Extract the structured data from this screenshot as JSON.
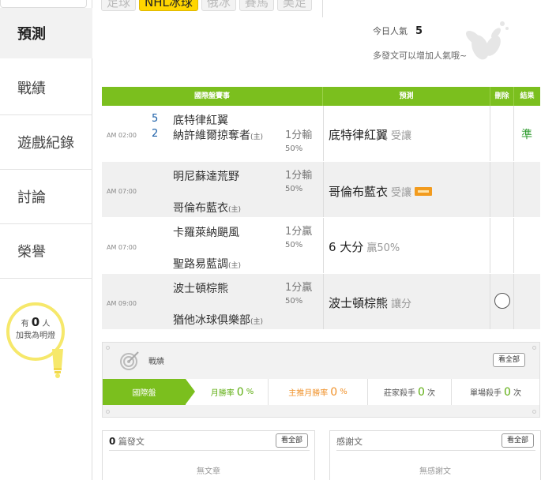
{
  "tabs": [
    {
      "label": "足球"
    },
    {
      "label": "NHL冰球"
    },
    {
      "label": "俄冰"
    },
    {
      "label": "賽馬"
    },
    {
      "label": "美足"
    }
  ],
  "sidebar": {
    "items": [
      {
        "label": "預測"
      },
      {
        "label": "戰績"
      },
      {
        "label": "遊戲紀錄"
      },
      {
        "label": "討論"
      },
      {
        "label": "榮譽"
      }
    ],
    "fans_prefix": "有",
    "fans_count": "0",
    "fans_unit": "人",
    "fans_text": "加我為明燈"
  },
  "popularity": {
    "label": "今日人氣",
    "value": "5",
    "hint": "多發文可以增加人氣哦~"
  },
  "table": {
    "headers": [
      "國際盤賽事",
      "預測",
      "刪除",
      "結果"
    ],
    "rows": [
      {
        "time": "AM 02:00",
        "score_home": "5",
        "score_away": "2",
        "team_a": "底特律紅翼",
        "team_b": "納許維爾掠奪者",
        "home_mark": "(主)",
        "line": "1分輸",
        "pct": "50%",
        "pick": "底特律紅翼",
        "pick_sub": "受讓",
        "result": "準"
      },
      {
        "time": "AM 07:00",
        "team_a": "明尼蘇達荒野",
        "team_b": "哥倫布藍衣",
        "home_mark": "(主)",
        "line": "1分輸",
        "pct": "50%",
        "pick": "哥倫布藍衣",
        "pick_sub": "受讓"
      },
      {
        "time": "AM 07:00",
        "team_a": "卡羅萊納颶風",
        "team_b": "聖路易藍調",
        "home_mark": "(主)",
        "line": "1分贏",
        "pct": "50%",
        "pick": "6 大分",
        "pick_sub": "贏50%"
      },
      {
        "time": "AM 09:00",
        "team_a": "波士頓棕熊",
        "team_b": "猶他冰球俱樂部",
        "home_mark": "(主)",
        "line": "1分贏",
        "pct": "50%",
        "pick": "波士頓棕熊",
        "pick_sub": "讓分"
      }
    ]
  },
  "stats": {
    "title": "戰績",
    "view_all": "看全部",
    "tab": "國際盤",
    "monthly_label": "月勝率",
    "monthly_value": "0",
    "main_label": "主推月勝率",
    "main_value": "0",
    "pct": "%",
    "banker_label": "莊家殺手",
    "banker_value": "0",
    "single_label": "單場殺手",
    "single_value": "0",
    "times": "次"
  },
  "posts": {
    "count": "0",
    "label": "篇發文",
    "view_all": "看全部",
    "empty": "無文章"
  },
  "thanks": {
    "label": "感謝文",
    "view_all": "看全部",
    "empty": "無感謝文"
  },
  "colors": {
    "green": "#7bbf1e",
    "yellow": "#ffd600",
    "orange": "#f0922b"
  }
}
